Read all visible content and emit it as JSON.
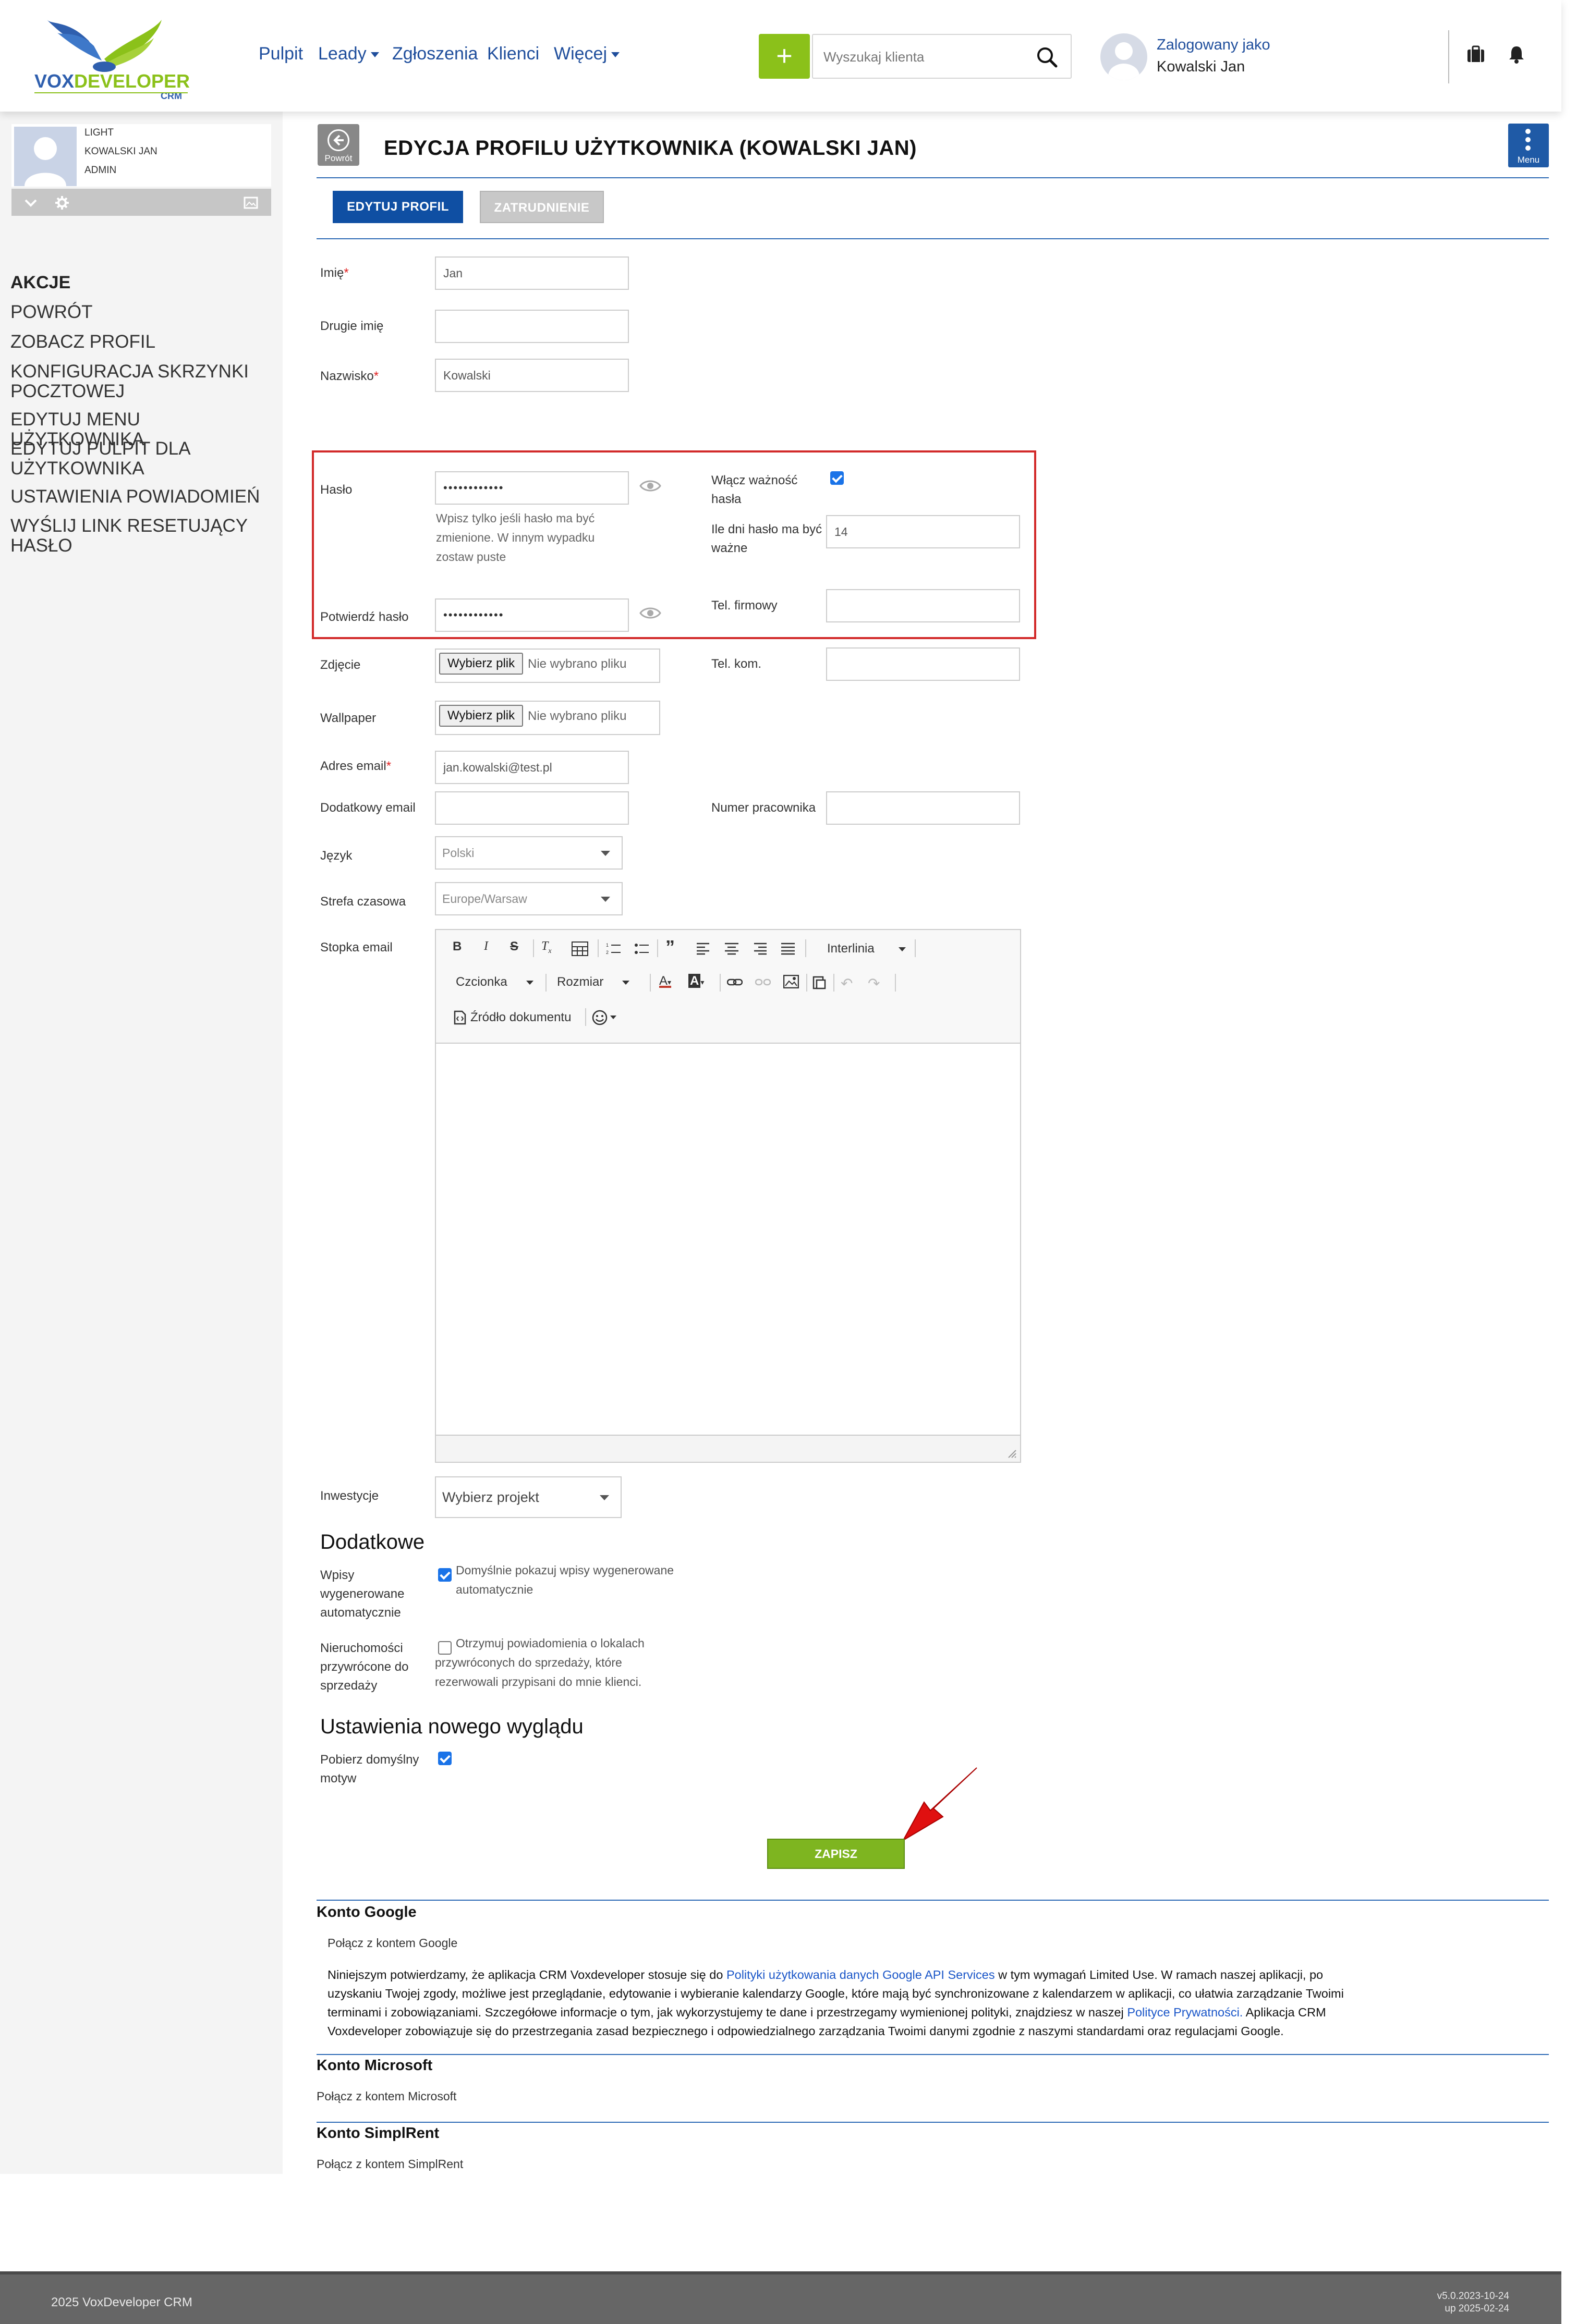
{
  "app": {
    "brand": "VOXDEVELOPER CRM",
    "brand_colors": {
      "primary": "#1f4e9c",
      "accent_green": "#8bc11a",
      "alert_red": "#d22a2a"
    }
  },
  "header": {
    "nav": [
      "Pulpit",
      "Leady",
      "Zgłoszenia",
      "Klienci",
      "Więcej"
    ],
    "add_button": "+",
    "search_placeholder": "Wyszukaj klienta",
    "logged_label": "Zalogowany jako",
    "logged_name": "Kowalski Jan",
    "icons": [
      "briefcase-icon",
      "bell-icon"
    ]
  },
  "sidebar": {
    "profile": {
      "line1": "LIGHT",
      "line2": "KOWALSKI JAN",
      "line3": "ADMIN"
    },
    "heading": "AKCJE",
    "links": [
      "POWRÓT",
      "ZOBACZ PROFIL",
      "KONFIGURACJA SKRZYNKI POCZTOWEJ",
      "EDYTUJ MENU UŻYTKOWNIKA",
      "EDYTUJ PULPIT DLA UŻYTKOWNIKA",
      "USTAWIENIA POWIADOMIEŃ",
      "WYŚLIJ LINK RESETUJĄCY HASŁO"
    ]
  },
  "page": {
    "back_label": "Powrót",
    "title": "EDYCJA PROFILU UŻYTKOWNIKA (KOWALSKI JAN)",
    "menu_label": "Menu",
    "tabs": [
      "EDYTUJ PROFIL",
      "ZATRUDNIENIE"
    ]
  },
  "form": {
    "first_name": {
      "label": "Imię",
      "value": "Jan"
    },
    "middle_name": {
      "label": "Drugie imię",
      "value": ""
    },
    "last_name": {
      "label": "Nazwisko",
      "value": "Kowalski"
    },
    "password": {
      "label": "Hasło",
      "value": "••••••••••••",
      "hint": "Wpisz tylko jeśli hasło ma być zmienione. W innym wypadku zostaw puste"
    },
    "confirm_password": {
      "label": "Potwierdź hasło",
      "value": "••••••••••••"
    },
    "password_expiry": {
      "label": "Włącz ważność hasła",
      "checked": true
    },
    "password_days": {
      "label": "Ile dni hasło ma być ważne",
      "value": "14"
    },
    "company_phone": {
      "label": "Tel. firmowy",
      "value": ""
    },
    "photo": {
      "label": "Zdjęcie",
      "button": "Wybierz plik",
      "status": "Nie wybrano pliku"
    },
    "mobile_phone": {
      "label": "Tel. kom.",
      "value": ""
    },
    "wallpaper": {
      "label": "Wallpaper",
      "button": "Wybierz plik",
      "status": "Nie wybrano pliku"
    },
    "email": {
      "label": "Adres email",
      "value": "jan.kowalski@test.pl"
    },
    "extra_email": {
      "label": "Dodatkowy email",
      "value": ""
    },
    "employee_number": {
      "label": "Numer pracownika",
      "value": ""
    },
    "language": {
      "label": "Język",
      "value": "Polski"
    },
    "timezone": {
      "label": "Strefa czasowa",
      "value": "Europe/Warsaw"
    },
    "signature": {
      "label": "Stopka email"
    },
    "investments": {
      "label": "Inwestycje",
      "value": "Wybierz projekt"
    }
  },
  "editor": {
    "line_height": "Interlinia",
    "font": "Czcionka",
    "size": "Rozmiar",
    "source": "Źródło dokumentu"
  },
  "extra": {
    "heading": "Dodatkowe",
    "auto_entries": {
      "label": "Wpisy wygenerowane automatycznie",
      "text": "Domyślnie pokazuj wpisy wygenerowane automatycznie",
      "checked": true
    },
    "restored": {
      "label": "Nieruchomości przywrócone do sprzedaży",
      "text": "Otrzymuj powiadomienia o lokalach przywróconych do sprzedaży, które rezerwowali przypisani do mnie klienci.",
      "checked": false
    }
  },
  "new_look": {
    "heading": "Ustawienia nowego wyglądu",
    "default_theme": {
      "label": "Pobierz domyślny motyw",
      "checked": true
    }
  },
  "save_button": "ZAPISZ",
  "accounts": {
    "google": {
      "heading": "Konto Google",
      "link": "Połącz z kontem Google",
      "p1": "Niniejszym potwierdzamy, że aplikacja CRM Voxdeveloper stosuje się do ",
      "p1_link": "Polityki użytkowania danych Google API Services",
      "p2": " w tym wymagań Limited Use. W ramach naszej aplikacji, po uzyskaniu Twojej zgody, możliwe jest przeglądanie, edytowanie i wybieranie kalendarzy Google, które mają być synchronizowane z kalendarzem w aplikacji, co ułatwia zarządzanie Twoimi terminami i zobowiązaniami. Szczegółowe informacje o tym, jak wykorzystujemy te dane i przestrzegamy wymienionej polityki, znajdziesz w naszej ",
      "p2_link": "Polityce Prywatności.",
      "p3": " Aplikacja CRM Voxdeveloper zobowiązuje się do przestrzegania zasad bezpiecznego i odpowiedzialnego zarządzania Twoimi danymi zgodnie z naszymi standardami oraz regulacjami Google."
    },
    "microsoft": {
      "heading": "Konto Microsoft",
      "link": "Połącz z kontem Microsoft"
    },
    "simplrent": {
      "heading": "Konto SimplRent",
      "link": "Połącz z kontem SimplRent"
    }
  },
  "footer": {
    "copyright": "2025 VoxDeveloper CRM",
    "version": "v5.0.2023-10-24",
    "updated": "up 2025-02-24"
  }
}
